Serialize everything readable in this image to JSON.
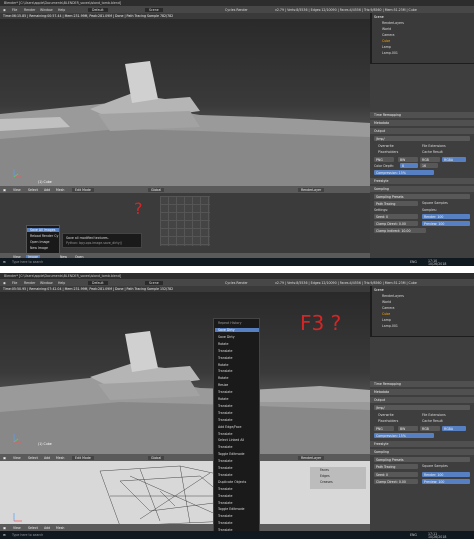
{
  "window_title": "Blender* [C:\\Users\\apple\\Documents\\BLENDER_saves\\island_tomb.blend]",
  "menus": [
    "File",
    "Render",
    "Window",
    "Help"
  ],
  "layout": "Default",
  "scene": "Scene",
  "render_engine": "Cycles Render",
  "version_stats": "v2.79 | Verts:8/5536 | Edges:12/10090 | Faces:4/4556 | Tris:9/8560 | Mem:51.23M | Cube",
  "top": {
    "render_status": "Time:06:15.85 | Remaining:00:57.44 | Mem:231.99M, Peak:281.09M | Done | Path Tracing Sample 782/782",
    "object_label": "(1) Cube",
    "viewport_menu": [
      "View",
      "Select",
      "Add",
      "Mesh"
    ],
    "mode": "Edit Mode",
    "pivot": "Global",
    "render_layer": "RenderLayer",
    "image_menu": [
      "View",
      "Image"
    ],
    "image_new": "New",
    "image_open": "Open",
    "image_dropdown": {
      "items": [
        "Save All Images",
        "Reload Render Cy",
        "Open Image",
        "New Image"
      ],
      "selected": "Save All Images"
    },
    "tooltip": {
      "line1": "Save all modified textures.",
      "line2": "Python: bpy.ops.image.save_dirty()"
    },
    "annotation": "?",
    "clock": {
      "time": "17:10",
      "date": "10/26/2018",
      "lang": "ENG"
    }
  },
  "bottom": {
    "render_status": "Time:05:50.95 | Remaining:07:42.04 | Mem:231.99M, Peak:281.09M | Done | Path Tracing Sample 152/782",
    "object_label": "(1) Cube",
    "viewport_menu": [
      "View",
      "Select",
      "Add",
      "Mesh"
    ],
    "mode": "Edit Mode",
    "pivot": "Global",
    "render_layer": "RenderLayer",
    "annotation": "F3 ?",
    "history": {
      "title": "Repeat History",
      "items": [
        "Save Dirty",
        "Save Dirty",
        "Rotate",
        "Translate",
        "Translate",
        "Rotate",
        "Translate",
        "Rotate",
        "Resize",
        "Translate",
        "Rotate",
        "Translate",
        "Translate",
        "Translate",
        "Add Edge/Face",
        "Translate",
        "Select Linked All",
        "Translate",
        "Toggle Editmode",
        "Translate",
        "Translate",
        "Translate",
        "Duplicate Objects",
        "Translate",
        "Translate",
        "Translate",
        "Toggle Editmode",
        "Translate",
        "Translate",
        "Translate"
      ],
      "selected": "Save Dirty"
    },
    "mesh_select": [
      "Faces",
      "Edges",
      "Creases"
    ],
    "clock": {
      "time": "17:11",
      "date": "10/26/2018",
      "lang": "ENG"
    }
  },
  "outliner": {
    "items": [
      "Scene",
      "RenderLayers",
      "World",
      "Camera",
      "Cube",
      "Lamp",
      "Lamp.001"
    ]
  },
  "properties": {
    "dimensions": "Dimensions",
    "metadata": "Metadata",
    "output": "Output",
    "output_path": "/tmp/",
    "overwrite": "Overwrite",
    "file_extensions": "File Extensions",
    "placeholders": "Placeholders",
    "cache_result": "Cache Result",
    "format": "PNG",
    "bw": "BW",
    "rgb": "RGB",
    "rgba": "RGBA",
    "color_depth_label": "Color Depth:",
    "color_depth_8": "8",
    "color_depth_16": "16",
    "compression": "Compression: 15%",
    "freestyle": "Freestyle",
    "sampling": "Sampling",
    "sampling_presets": "Sampling Presets",
    "path_tracing": "Path Tracing",
    "square_samples": "Square Samples",
    "settings": "Settings:",
    "samples": "Samples:",
    "seed": "Seed: 0",
    "render": "Render: 100",
    "clamp_direct": "Clamp Direct: 0.00",
    "preview": "Preview: 100",
    "clamp_indirect": "Clamp Indirect: 10.00",
    "time_remapping": "Time Remapping"
  },
  "taskbar": [
    "Type here to search"
  ]
}
